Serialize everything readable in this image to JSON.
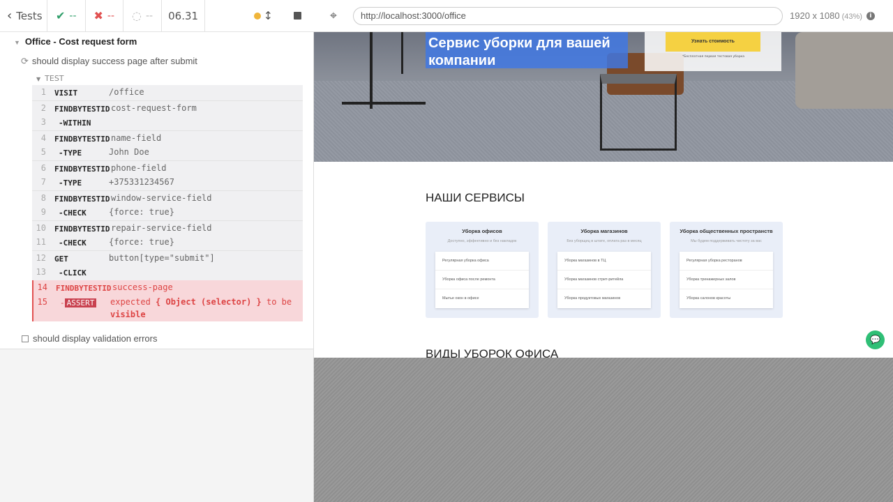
{
  "reporter": {
    "tests_label": "Tests",
    "passed": "--",
    "failed": "--",
    "pending": "--",
    "duration": "06.31"
  },
  "suite": {
    "title": "Office - Cost request form",
    "test1_title": "should display success page after submit",
    "test_header": "TEST",
    "test2_title": "should display validation errors"
  },
  "commands": [
    {
      "num": "1",
      "name": "VISIT",
      "arg": "/office"
    },
    {
      "num": "2",
      "name": "FINDBYTESTID",
      "arg": "cost-request-form"
    },
    {
      "num": "3",
      "name": "-WITHIN",
      "arg": ""
    },
    {
      "num": "4",
      "name": "FINDBYTESTID",
      "arg": "name-field"
    },
    {
      "num": "5",
      "name": "-TYPE",
      "arg": "John Doe"
    },
    {
      "num": "6",
      "name": "FINDBYTESTID",
      "arg": "phone-field"
    },
    {
      "num": "7",
      "name": "-TYPE",
      "arg": "+375331234567"
    },
    {
      "num": "8",
      "name": "FINDBYTESTID",
      "arg": "window-service-field"
    },
    {
      "num": "9",
      "name": "-CHECK",
      "arg": "{force: true}"
    },
    {
      "num": "10",
      "name": "FINDBYTESTID",
      "arg": "repair-service-field"
    },
    {
      "num": "11",
      "name": "-CHECK",
      "arg": "{force: true}"
    },
    {
      "num": "12",
      "name": "GET",
      "arg": "button[type=\"submit\"]"
    },
    {
      "num": "13",
      "name": "-CLICK",
      "arg": ""
    },
    {
      "num": "14",
      "name": "FINDBYTESTID",
      "arg": "success-page"
    },
    {
      "num": "15",
      "name": "ASSERT",
      "arg_prefix": "expected",
      "arg_sel": "{ Object (selector) }",
      "arg_mid": "to be",
      "arg_end": "visible"
    }
  ],
  "aut": {
    "url": "http://localhost:3000/office",
    "viewport": "1920 x 1080",
    "zoom": "(43%)"
  },
  "site": {
    "hero_title": "Сервис уборки для вашей компании",
    "hero_button": "Узнать стоимость",
    "hero_note": "*Бесплатная первая тестовая уборка",
    "services_title": "НАШИ СЕРВИСЫ",
    "types_title": "ВИДЫ УБОРОК ОФИСА",
    "cards": [
      {
        "title": "Уборка офисов",
        "sub": "Доступно, эффективно и без накладок",
        "items": [
          "Регулярная уборка офиса",
          "Уборка офиса после ремонта",
          "Мытье окон в офисе"
        ]
      },
      {
        "title": "Уборка магазинов",
        "sub": "Без уборщиц в штате, оплата раз в месяц",
        "items": [
          "Уборка магазинов в ТЦ",
          "Уборка магазинов стрит-ритейла",
          "Уборка продуктовых магазинов"
        ]
      },
      {
        "title": "Уборка общественных пространств",
        "sub": "Мы будем поддерживать чистоту за вас",
        "items": [
          "Регулярная уборка ресторанов",
          "Уборка тренажерных залов",
          "Уборка салонов красоты"
        ]
      }
    ]
  },
  "colors": {
    "passed": "#2f9e6a",
    "failed": "#e15050",
    "accent": "#3e78e6",
    "cta": "#f5d142"
  }
}
